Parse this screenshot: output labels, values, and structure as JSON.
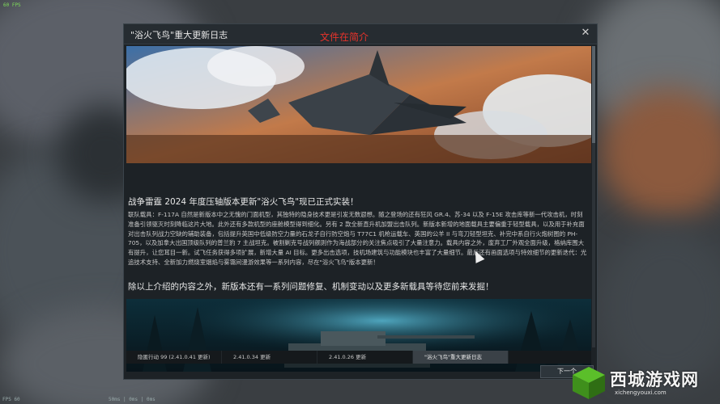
{
  "hud": {
    "fps_top": "60 FPS",
    "fps_bottom": "FPS 60",
    "stats_bottom": "50ms | 0ms | 0ms"
  },
  "dialog": {
    "title": "\"浴火飞鸟\"重大更新日志",
    "overlay_title": "文件在简介",
    "close_icon": "close-icon",
    "headline": "战争雷霆 2024 年度压轴版本更新\"浴火飞鸟\"现已正式实装！",
    "body": "联队载具：F-117A 自然是新版本中之无愧的门面机型，其独特的隐身技术更是引发无数遐想。随之登场的还有狂风 GR.4、苏-34 以及 F-15E 攻击库等新一代攻击机，时刻准备引领驱灭时刻降临这片大地。此外还有多款机型的座舱模型得到细化。另有 2 款全新直升机加盟出击队列。新版本新增的地面载具主要偏重于轻型载具，以及用于补充面对出击队列战力空缺的辅助装备，包括提升英国中低级防空力量的石龙子自行防空炮与 T77C1 机枪运载车、英国的公羊 II 与弯刀轻型坦克、补完中系自行火炮树图的 PH-705，以及加拿大出国顶级队列的普兰豹 7 主战坦克。被割剿克号战列舰则作为海战部分的关注焦点吸引了大量注意力。载具内容之外，废弃工厂外观全面升级，格纳库围大有提升，让您耳目一新。试飞任务获得多项扩展，新增大量 AI 目标。更多出击选项，技机场建筑与功能模块也丰富了大量细节。最后还有画面选项与特效细节的更新迭代：光追技术支持、全新加力燃烧室烟焰与雾霭间漫游效果等一系列内容，尽在\"浴火飞鸟\"版本更新！",
    "conclusion": "除以上介绍的内容之外，新版本还有一系列问题修复、机制变动以及更多新载具等待您前来发掘！",
    "tabs": [
      {
        "label": "隐匿行动 99 (2.41.0.41 更新)"
      },
      {
        "label": "2.41.0.34 更新"
      },
      {
        "label": "2.41.0.26 更新"
      },
      {
        "label": "\"浴火飞鸟\"重大更新日志"
      }
    ],
    "active_tab": 3,
    "next_button": "下一个"
  },
  "watermark": {
    "text": "西城游戏网",
    "url": "xichengyouxi.com"
  },
  "colors": {
    "accent_red": "#e8332b",
    "dialog_bg": "#1d2226",
    "hud_green": "#7fdc5a"
  }
}
